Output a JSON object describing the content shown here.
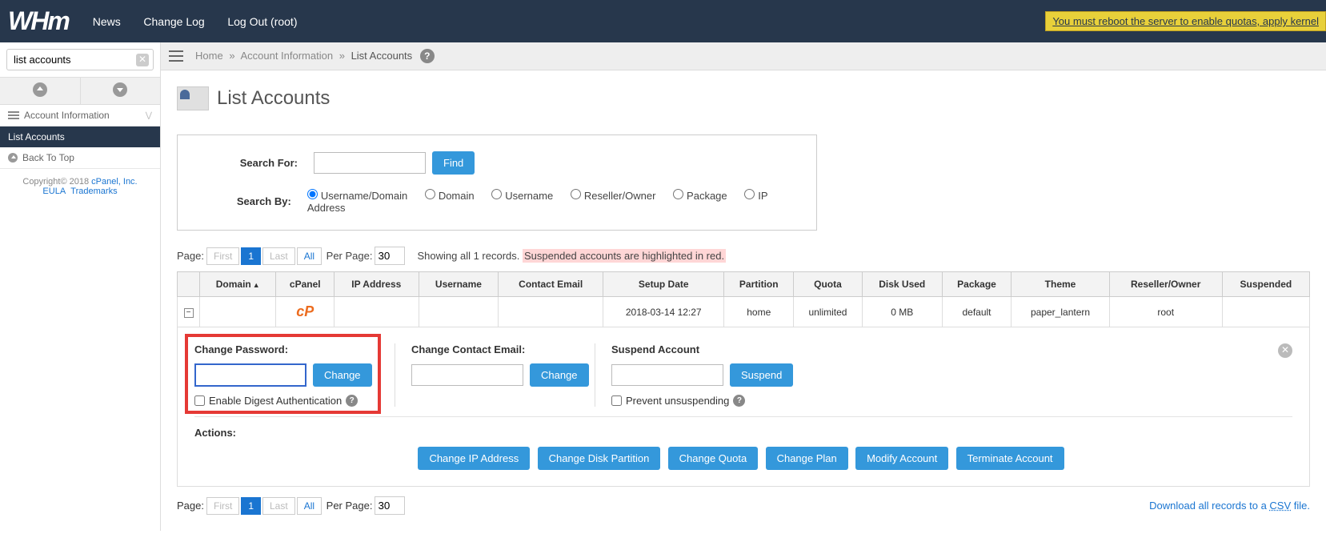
{
  "header": {
    "logo": "WHm",
    "nav": {
      "news": "News",
      "changelog": "Change Log",
      "logout": "Log Out (root)"
    },
    "alert": "You must reboot the server to enable quotas, apply kernel"
  },
  "sidebar": {
    "search_value": "list accounts",
    "section_title": "Account Information",
    "active_item": "List Accounts",
    "back_to_top": "Back To Top",
    "copyright": "Copyright© 2018 ",
    "cpanel_link": "cPanel, Inc.",
    "eula": "EULA",
    "trademarks": "Trademarks"
  },
  "breadcrumb": {
    "home": "Home",
    "section": "Account Information",
    "page": "List Accounts"
  },
  "page": {
    "title": "List Accounts"
  },
  "search_panel": {
    "search_for_label": "Search For:",
    "find_button": "Find",
    "search_by_label": "Search By:",
    "options": {
      "username_domain": "Username/Domain",
      "domain": "Domain",
      "username": "Username",
      "reseller_owner": "Reseller/Owner",
      "package": "Package",
      "ip_address": "IP Address"
    }
  },
  "pager": {
    "page_label": "Page:",
    "first": "First",
    "page_num": "1",
    "last": "Last",
    "all": "All",
    "per_page_label": "Per Page:",
    "per_page_value": "30",
    "showing": "Showing all 1 records. ",
    "suspended_note": "Suspended accounts are highlighted in red."
  },
  "table": {
    "headers": {
      "domain": "Domain",
      "cpanel": "cPanel",
      "ip": "IP Address",
      "username": "Username",
      "email": "Contact Email",
      "setup": "Setup Date",
      "partition": "Partition",
      "quota": "Quota",
      "disk": "Disk Used",
      "package": "Package",
      "theme": "Theme",
      "reseller": "Reseller/Owner",
      "suspended": "Suspended"
    },
    "row": {
      "setup": "2018-03-14 12:27",
      "partition": "home",
      "quota": "unlimited",
      "disk": "0 MB",
      "package": "default",
      "theme": "paper_lantern",
      "reseller": "root"
    }
  },
  "expanded": {
    "change_password_label": "Change Password:",
    "change_button": "Change",
    "digest_auth": "Enable Digest Authentication",
    "change_email_label": "Change Contact Email:",
    "suspend_label": "Suspend Account",
    "suspend_button": "Suspend",
    "prevent_unsuspend": "Prevent unsuspending",
    "actions_label": "Actions:",
    "actions": {
      "change_ip": "Change IP Address",
      "change_disk": "Change Disk Partition",
      "change_quota": "Change Quota",
      "change_plan": "Change Plan",
      "modify": "Modify Account",
      "terminate": "Terminate Account"
    }
  },
  "download": {
    "prefix": "Download all records to a ",
    "csv": "CSV",
    "suffix": " file."
  }
}
